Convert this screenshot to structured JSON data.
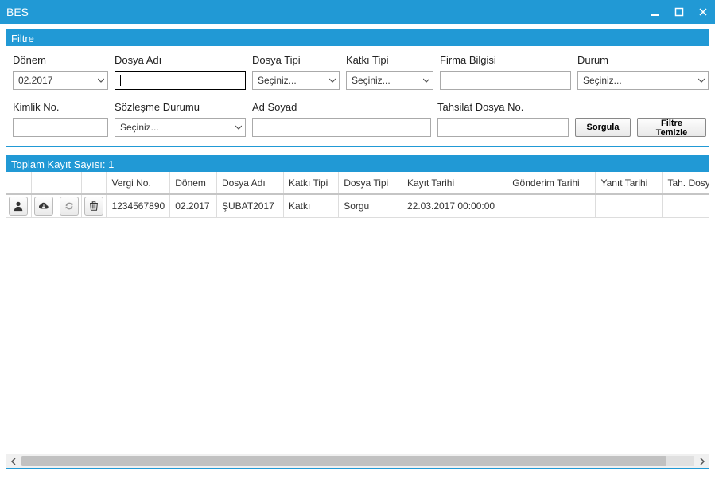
{
  "window": {
    "title": "BES"
  },
  "filter": {
    "panel_title": "Filtre",
    "labels": {
      "donem": "Dönem",
      "dosya_adi": "Dosya Adı",
      "dosya_tipi": "Dosya Tipi",
      "katki_tipi": "Katkı Tipi",
      "firma_bilgisi": "Firma Bilgisi",
      "durum": "Durum",
      "kimlik_no": "Kimlik No.",
      "sozlesme_durumu": "Sözleşme Durumu",
      "ad_soyad": "Ad Soyad",
      "tahsilat_dosya_no": "Tahsilat Dosya No."
    },
    "values": {
      "donem": "02.2017",
      "dosya_adi": "",
      "dosya_tipi": "Seçiniz...",
      "katki_tipi": "Seçiniz...",
      "firma_bilgisi": "",
      "durum": "Seçiniz...",
      "kimlik_no": "",
      "sozlesme_durumu": "Seçiniz...",
      "ad_soyad": "",
      "tahsilat_dosya_no": ""
    },
    "buttons": {
      "sorgula": "Sorgula",
      "temizle": "Filtre Temizle"
    }
  },
  "results": {
    "summary": "Toplam Kayıt Sayısı: 1",
    "columns": {
      "vergi_no": "Vergi No.",
      "donem": "Dönem",
      "dosya_adi": "Dosya Adı",
      "katki_tipi": "Katkı Tipi",
      "dosya_tipi": "Dosya Tipi",
      "kayit_tarihi": "Kayıt Tarihi",
      "gonderim_tarihi": "Gönderim Tarihi",
      "yanit_tarihi": "Yanıt Tarihi",
      "tah_dosya_no": "Tah. Dosya No."
    },
    "rows": [
      {
        "vergi_no": "1234567890",
        "donem": "02.2017",
        "dosya_adi": "ŞUBAT2017",
        "katki_tipi": "Katkı",
        "dosya_tipi": "Sorgu",
        "kayit_tarihi": "22.03.2017 00:00:00",
        "gonderim_tarihi": "",
        "yanit_tarihi": "",
        "tah_dosya_no": ""
      }
    ]
  }
}
